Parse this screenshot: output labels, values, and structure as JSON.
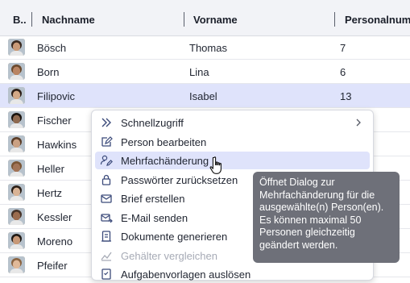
{
  "columns": [
    "B...",
    "Nachname",
    "Vorname",
    "Personalnum..."
  ],
  "rows": [
    {
      "nachname": "Bösch",
      "vorname": "Thomas",
      "nr": "7"
    },
    {
      "nachname": "Born",
      "vorname": "Lina",
      "nr": "6"
    },
    {
      "nachname": "Filipovic",
      "vorname": "Isabel",
      "nr": "13",
      "selected": true
    },
    {
      "nachname": "Fischer",
      "vorname": "",
      "nr": ""
    },
    {
      "nachname": "Hawkins",
      "vorname": "",
      "nr": ""
    },
    {
      "nachname": "Heller",
      "vorname": "",
      "nr": ""
    },
    {
      "nachname": "Hertz",
      "vorname": "",
      "nr": ""
    },
    {
      "nachname": "Kessler",
      "vorname": "",
      "nr": ""
    },
    {
      "nachname": "Moreno",
      "vorname": "",
      "nr": ""
    },
    {
      "nachname": "Pfeifer",
      "vorname": "",
      "nr": ""
    }
  ],
  "menu": {
    "items": [
      {
        "label": "Schnellzugriff",
        "icon": "double-chevron-right-icon",
        "submenu": true
      },
      {
        "label": "Person bearbeiten",
        "icon": "edit-icon"
      },
      {
        "label": "Mehrfachänderung",
        "icon": "users-edit-icon",
        "hover": true
      },
      {
        "label": "Passwörter zurücksetzen",
        "icon": "lock-icon"
      },
      {
        "label": "Brief erstellen",
        "icon": "mail-icon"
      },
      {
        "label": "E-Mail senden",
        "icon": "mail-send-icon"
      },
      {
        "label": "Dokumente generieren",
        "icon": "document-icon"
      },
      {
        "label": "Gehälter vergleichen",
        "icon": "chart-icon",
        "disabled": true
      },
      {
        "label": "Aufgabenvorlagen auslösen",
        "icon": "tasks-icon"
      }
    ]
  },
  "tooltip": {
    "lines": [
      "Öffnet Dialog zur",
      "Mehrfachänderung für die",
      "ausgewählte(n) Person(en).",
      "Es können maximal 50",
      "Personen gleichzeitig",
      "geändert werden."
    ]
  },
  "colors": {
    "selected_row": "#dfe3fb",
    "tooltip_bg": "#6e7079",
    "header_bg": "#f2f3f7"
  }
}
